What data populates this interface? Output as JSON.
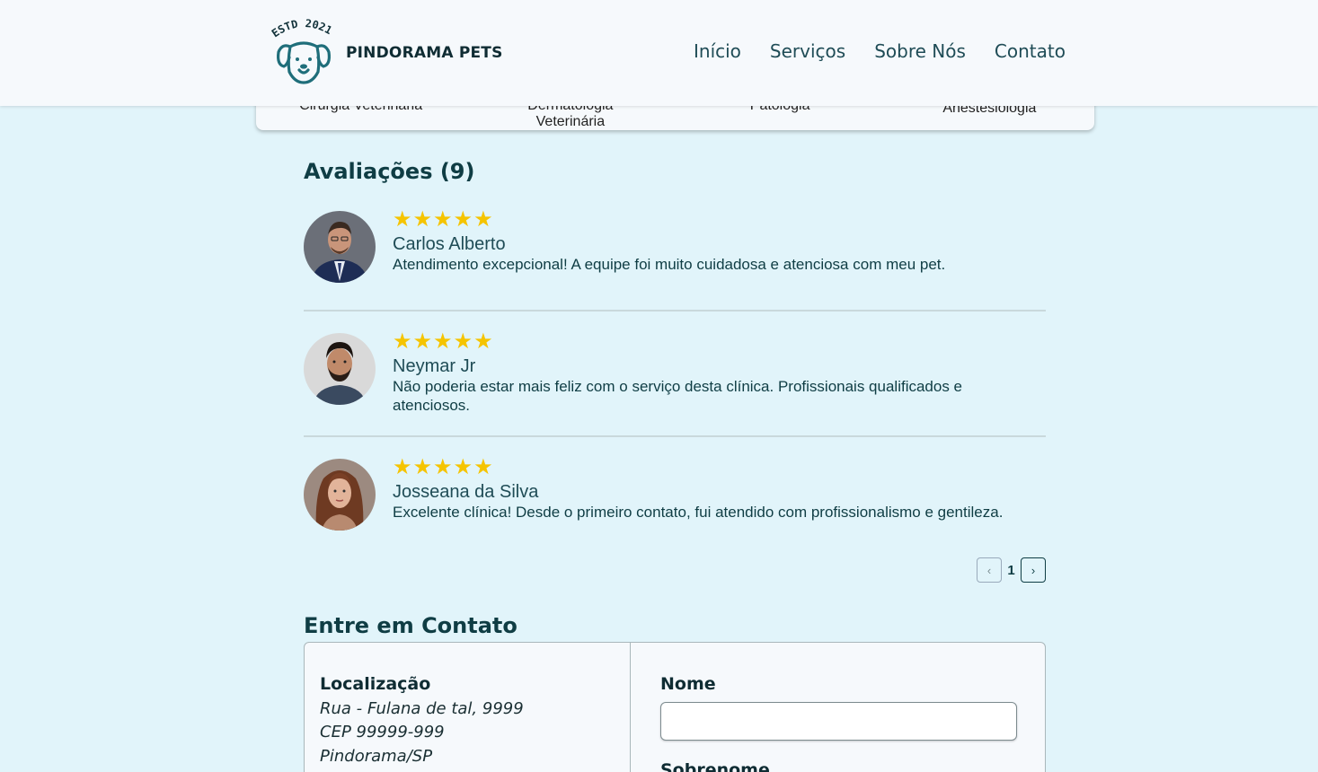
{
  "header": {
    "logo_text": "ESTD 2021",
    "brand": "PINDORAMA PETS",
    "nav": [
      "Início",
      "Serviços",
      "Sobre Nós",
      "Contato"
    ]
  },
  "services": [
    {
      "line1": "Cirurgia Veterinária",
      "line2": ""
    },
    {
      "line1": "Dermatologia",
      "line2": "Veterinária"
    },
    {
      "line1": "Patologia",
      "line2": ""
    },
    {
      "line1": "Anestesiologia",
      "line2": ""
    }
  ],
  "reviews": {
    "title": "Avaliações (9)",
    "items": [
      {
        "stars": "★★★★★",
        "name": "Carlos Alberto",
        "text": "Atendimento excepcional! A equipe foi muito cuidadosa e atenciosa com meu pet."
      },
      {
        "stars": "★★★★★",
        "name": "Neymar Jr",
        "text": "Não poderia estar mais feliz com o serviço desta clínica. Profissionais qualificados e atenciosos."
      },
      {
        "stars": "★★★★★",
        "name": "Josseana da Silva",
        "text": "Excelente clínica! Desde o primeiro contato, fui atendido com profissionalismo e gentileza."
      }
    ],
    "pagination": {
      "prev": "‹",
      "page": "1",
      "next": "›"
    }
  },
  "contact": {
    "title": "Entre em Contato",
    "location_title": "Localização",
    "address": [
      "Rua - Fulana de tal, 9999",
      "CEP 99999-999",
      "Pindorama/SP"
    ],
    "form": {
      "nome_label": "Nome",
      "nome_value": "",
      "sobrenome_label": "Sobrenome"
    }
  }
}
